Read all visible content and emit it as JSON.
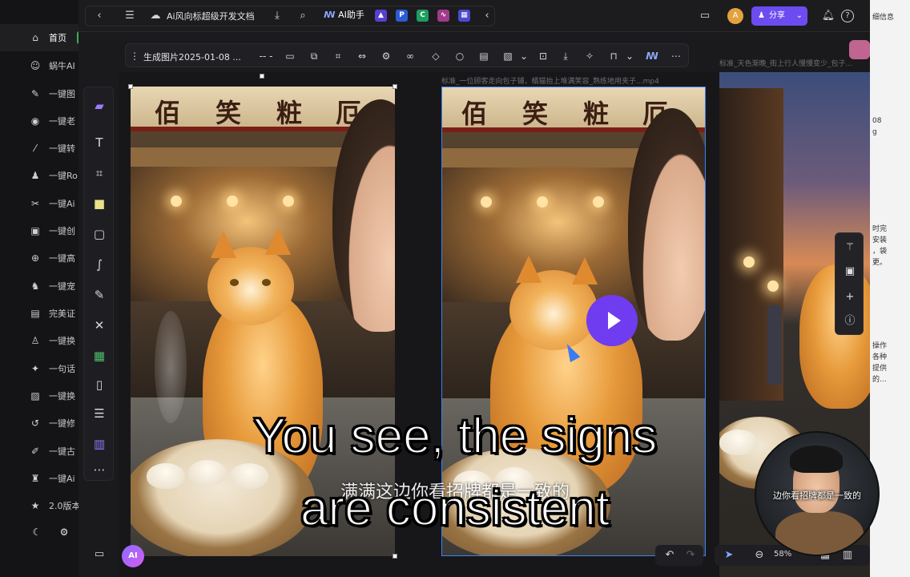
{
  "sidebar": {
    "items": [
      {
        "icon": "home-icon",
        "label": "首页",
        "active": true
      },
      {
        "icon": "robot-icon",
        "label": "蜗牛AI"
      },
      {
        "icon": "pen-icon",
        "label": "一键图"
      },
      {
        "icon": "palette-icon",
        "label": "一键老"
      },
      {
        "icon": "brush-icon",
        "label": "一键转"
      },
      {
        "icon": "user-icon",
        "label": "一键Ro"
      },
      {
        "icon": "scissors-icon",
        "label": "一键Ai"
      },
      {
        "icon": "image-icon",
        "label": "一键创"
      },
      {
        "icon": "zoom-icon",
        "label": "一键高"
      },
      {
        "icon": "dog-icon",
        "label": "一键宠"
      },
      {
        "icon": "id-card-icon",
        "label": "完美证"
      },
      {
        "icon": "person-icon",
        "label": "一键换"
      },
      {
        "icon": "magic-icon",
        "label": "一句话"
      },
      {
        "icon": "picture-icon",
        "label": "一键换"
      },
      {
        "icon": "restore-icon",
        "label": "一键修"
      },
      {
        "icon": "pencil-icon",
        "label": "一键古"
      },
      {
        "icon": "shirt-icon",
        "label": "一键Ai"
      },
      {
        "icon": "star-icon",
        "label": "2.0版本"
      }
    ]
  },
  "topbar": {
    "doc_title": "Ai风向标超级开发文档",
    "ai_assistant": "AI助手",
    "share_label": "分享",
    "avatar_letter": "A"
  },
  "canvas_toolbar": {
    "title": "生成图片2025-01-08 ...",
    "separator": "-- -"
  },
  "canvas": {
    "frame2_label": "标准_一位顾客走向包子铺，橘猫抬上堆满笑容_熟练地用夹子...mp4",
    "frame3_label": "标准_天色渐晚_街上行人慢慢变少_包子...",
    "sign_chars": [
      "佰",
      "笑",
      "粧",
      "厄"
    ]
  },
  "bottom": {
    "zoom": "58%"
  },
  "right_panel": {
    "header": "细信息",
    "snippets": [
      "08",
      "g",
      "时完",
      "安装",
      "，袋",
      "更。",
      "操作",
      "各种",
      "提供",
      "的..."
    ]
  },
  "presenter": {
    "caption": "边你看招牌都是一致的"
  },
  "subtitles": {
    "cn": "满满这边你看招牌都是一致的",
    "en_line1": "You see, the signs",
    "en_line2": "are consistent"
  },
  "colors": {
    "accent_purple": "#6c4cf0",
    "selection_blue": "#3b82f6",
    "sidebar_bg": "#141416"
  }
}
